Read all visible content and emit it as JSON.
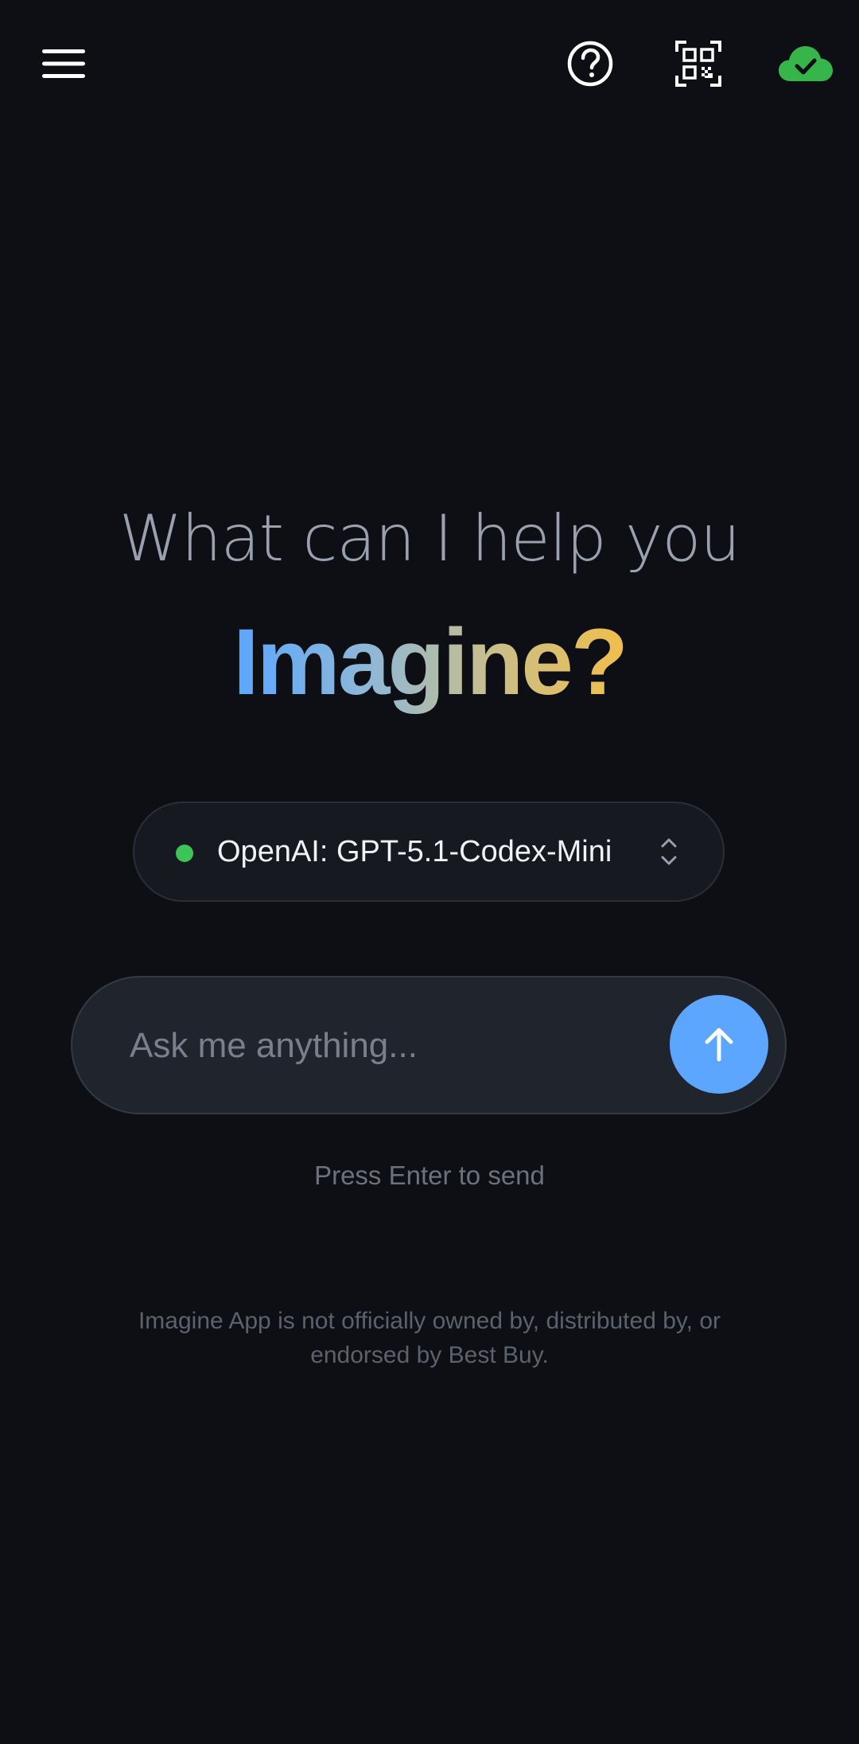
{
  "header": {
    "menu_icon": "hamburger-menu-icon",
    "help_icon": "question-circle-icon",
    "qr_icon": "qr-code-scan-icon",
    "sync_icon": "cloud-check-icon",
    "sync_color": "#35b54a"
  },
  "hero": {
    "subtitle": "What can I help you",
    "title": "Imagine?",
    "gradient": [
      "#5aa6ff",
      "#f0bf4c"
    ]
  },
  "model_selector": {
    "label": "OpenAI: GPT-5.1-Codex-Mini",
    "status_color": "#3cc45a",
    "icon": "chevron-up-down-icon"
  },
  "chat_input": {
    "placeholder": "Ask me anything...",
    "value": "",
    "send_icon": "arrow-up-icon",
    "send_color": "#5ca6ff"
  },
  "hint": "Press Enter to send",
  "disclaimer": "Imagine App is not officially owned by, distributed by, or endorsed by Best Buy."
}
